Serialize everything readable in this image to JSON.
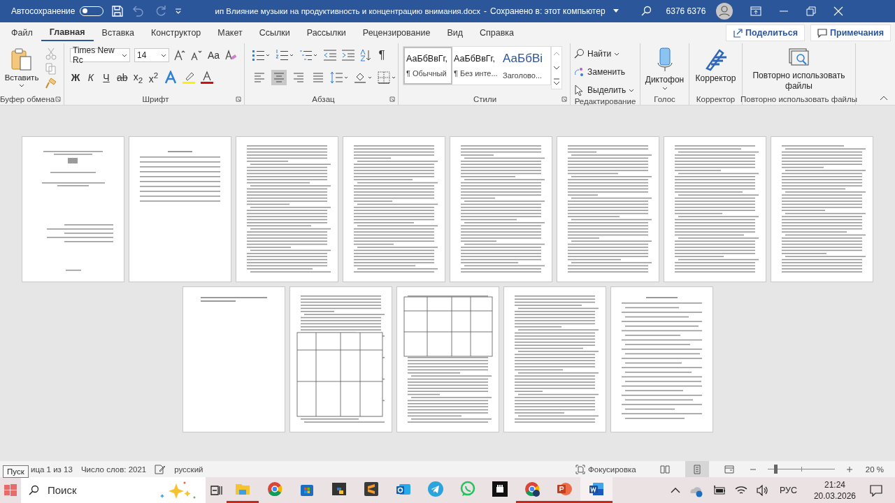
{
  "title_bar": {
    "autosave_label": "Автосохранение",
    "autosave_on": false,
    "title": "ип Влияние музыки на продуктивность и концентрацию внимания.docx",
    "separator": "-",
    "save_status": "Сохранено в: этот компьютер",
    "user": "6376 6376"
  },
  "tabs": [
    {
      "label": "Файл",
      "selected": false
    },
    {
      "label": "Главная",
      "selected": true
    },
    {
      "label": "Вставка",
      "selected": false
    },
    {
      "label": "Конструктор",
      "selected": false
    },
    {
      "label": "Макет",
      "selected": false
    },
    {
      "label": "Ссылки",
      "selected": false
    },
    {
      "label": "Рассылки",
      "selected": false
    },
    {
      "label": "Рецензирование",
      "selected": false
    },
    {
      "label": "Вид",
      "selected": false
    },
    {
      "label": "Справка",
      "selected": false
    }
  ],
  "share_button": "Поделиться",
  "comments_button": "Примечания",
  "ribbon": {
    "clipboard": {
      "paste": "Вставить",
      "label": "Буфер обмена"
    },
    "font": {
      "family": "Times New Rc",
      "size": "14",
      "case": "Aa",
      "bold": "Ж",
      "italic": "К",
      "underline": "Ч",
      "strike": "ab",
      "subscript": "x$_{2}$",
      "superscript": "x$^{2}$",
      "label": "Шрифт"
    },
    "paragraph": {
      "pilcrow": "¶",
      "alignments": [
        {
          "selected": false
        },
        {
          "selected": true
        },
        {
          "selected": false
        },
        {
          "selected": false
        }
      ],
      "label": "Абзац"
    },
    "styles": {
      "items": [
        {
          "preview": "АаБбВвГг,",
          "name": "¶ Обычный",
          "selected": true,
          "kind": "normal"
        },
        {
          "preview": "АаБбВвГг,",
          "name": "¶ Без инте...",
          "selected": false,
          "kind": "normal"
        },
        {
          "preview": "АаБбВі",
          "name": "Заголово...",
          "selected": false,
          "kind": "heading"
        }
      ],
      "label": "Стили"
    },
    "editing": {
      "find": "Найти",
      "replace": "Заменить",
      "select": "Выделить",
      "label": "Редактирование"
    },
    "voice": {
      "button": "Диктофон",
      "label": "Голос"
    },
    "editor": {
      "button": "Корректор",
      "label": "Корректор"
    },
    "reuse": {
      "button": "Повторно использовать файлы",
      "label": "Повторно использовать файлы"
    }
  },
  "pages": [
    {
      "kind": "title"
    },
    {
      "kind": "toc"
    },
    {
      "kind": "text"
    },
    {
      "kind": "text"
    },
    {
      "kind": "text"
    },
    {
      "kind": "text"
    },
    {
      "kind": "text"
    },
    {
      "kind": "text"
    },
    {
      "kind": "short"
    },
    {
      "kind": "table"
    },
    {
      "kind": "table"
    },
    {
      "kind": "text"
    },
    {
      "kind": "references"
    }
  ],
  "tooltip": "Пуск",
  "status_bar": {
    "page_info": "ица 1 из 13",
    "word_count": "Число слов: 2021",
    "language": "русский",
    "focus": "Фокусировка",
    "views": [
      {
        "selected": false
      },
      {
        "selected": true
      },
      {
        "selected": false
      }
    ],
    "zoom_slider": {
      "level": 0.12
    },
    "zoom": "20 %"
  },
  "taskbar": {
    "search_placeholder": "Поиск",
    "apps": [
      {
        "kind": "explorer",
        "running": true
      },
      {
        "kind": "chrome",
        "running": false
      },
      {
        "kind": "store",
        "running": false
      },
      {
        "kind": "python",
        "running": false
      },
      {
        "kind": "sublime",
        "running": false
      },
      {
        "kind": "outlook",
        "running": false
      },
      {
        "kind": "telegram",
        "running": false
      },
      {
        "kind": "whatsapp",
        "running": false
      },
      {
        "kind": "fist",
        "running": false
      },
      {
        "kind": "chrome-ext",
        "running": true
      },
      {
        "kind": "powerpoint",
        "running": true
      },
      {
        "kind": "word",
        "running": true
      }
    ],
    "language": "РУС",
    "time": "21:24",
    "date": "20.03.2026"
  }
}
